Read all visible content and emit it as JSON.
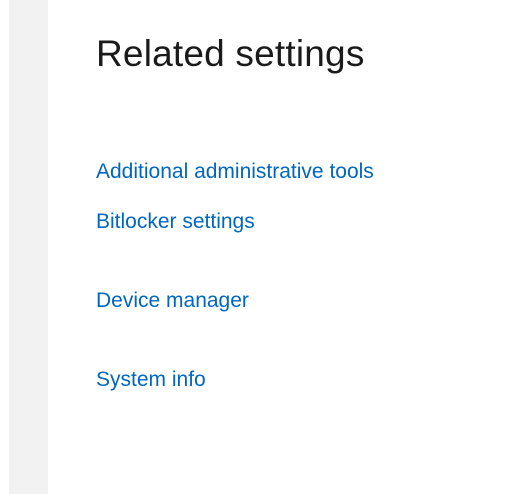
{
  "related_settings": {
    "title": "Related settings",
    "links": [
      {
        "label": "Additional administrative tools"
      },
      {
        "label": "Bitlocker settings"
      },
      {
        "label": "Device manager"
      },
      {
        "label": "System info"
      }
    ]
  },
  "colors": {
    "link": "#0067c0",
    "title": "#1a1a1a",
    "side_strip": "#f2f2f2",
    "background": "#ffffff"
  }
}
